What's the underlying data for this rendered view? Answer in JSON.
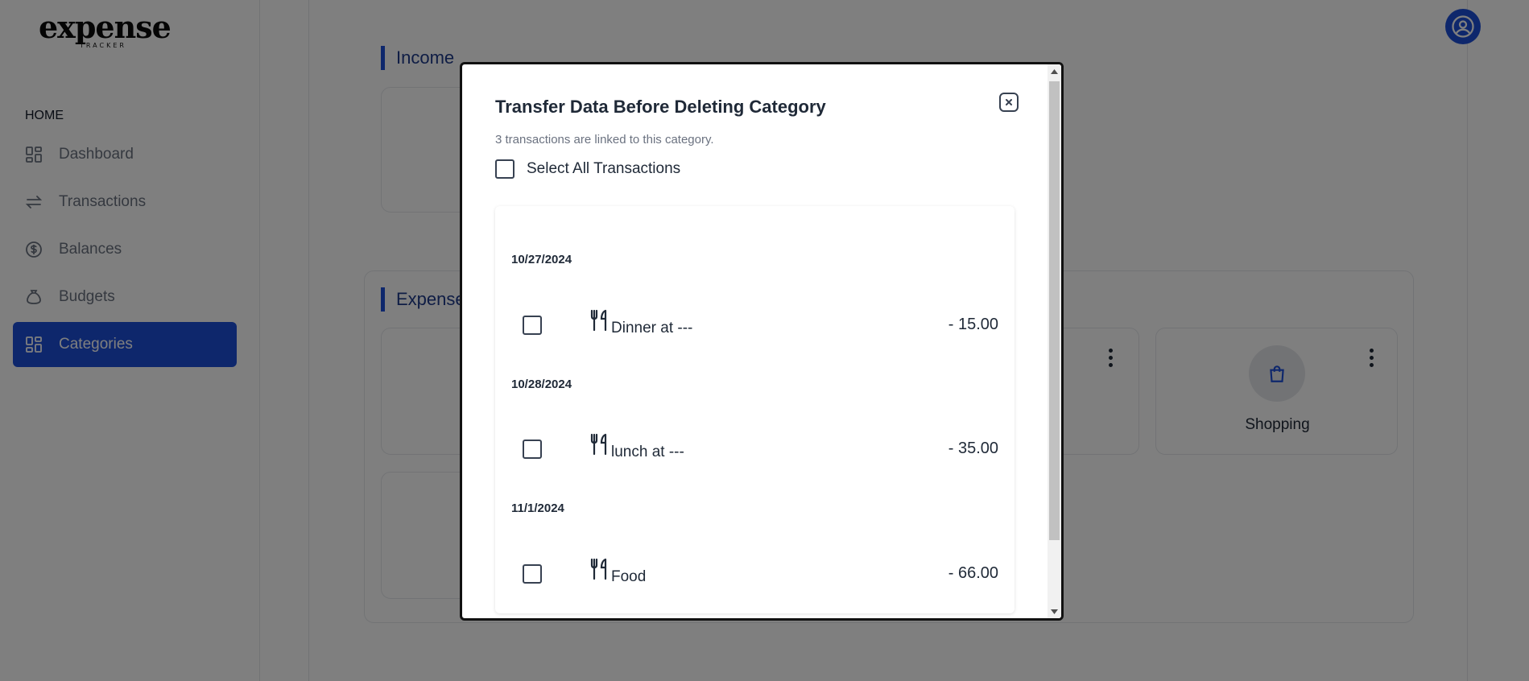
{
  "app": {
    "logo_main": "expense",
    "logo_sub": "TRACKER"
  },
  "sidebar": {
    "heading": "HOME",
    "items": [
      {
        "label": "Dashboard",
        "icon": "dashboard-icon",
        "active": false
      },
      {
        "label": "Transactions",
        "icon": "transfer-arrows-icon",
        "active": false
      },
      {
        "label": "Balances",
        "icon": "dollar-circle-icon",
        "active": false
      },
      {
        "label": "Budgets",
        "icon": "money-bag-icon",
        "active": false
      },
      {
        "label": "Categories",
        "icon": "grid-icon",
        "active": true
      }
    ]
  },
  "main": {
    "income_title": "Income",
    "expense_title": "Expenses",
    "shopping_label": "Shopping"
  },
  "modal": {
    "title": "Transfer Data Before Deleting Category",
    "linked_text": "3 transactions are linked to this category.",
    "select_all_label": "Select All Transactions",
    "transactions": [
      {
        "date": "10/27/2024",
        "name": "Dinner at ---",
        "amount": "- 15.00"
      },
      {
        "date": "10/28/2024",
        "name": "lunch at ---",
        "amount": "- 35.00"
      },
      {
        "date": "11/1/2024",
        "name": "Food",
        "amount": "- 66.00"
      }
    ]
  },
  "colors": {
    "accent": "#1d4ed8",
    "overlay": "rgba(0,0,0,0.5)"
  }
}
